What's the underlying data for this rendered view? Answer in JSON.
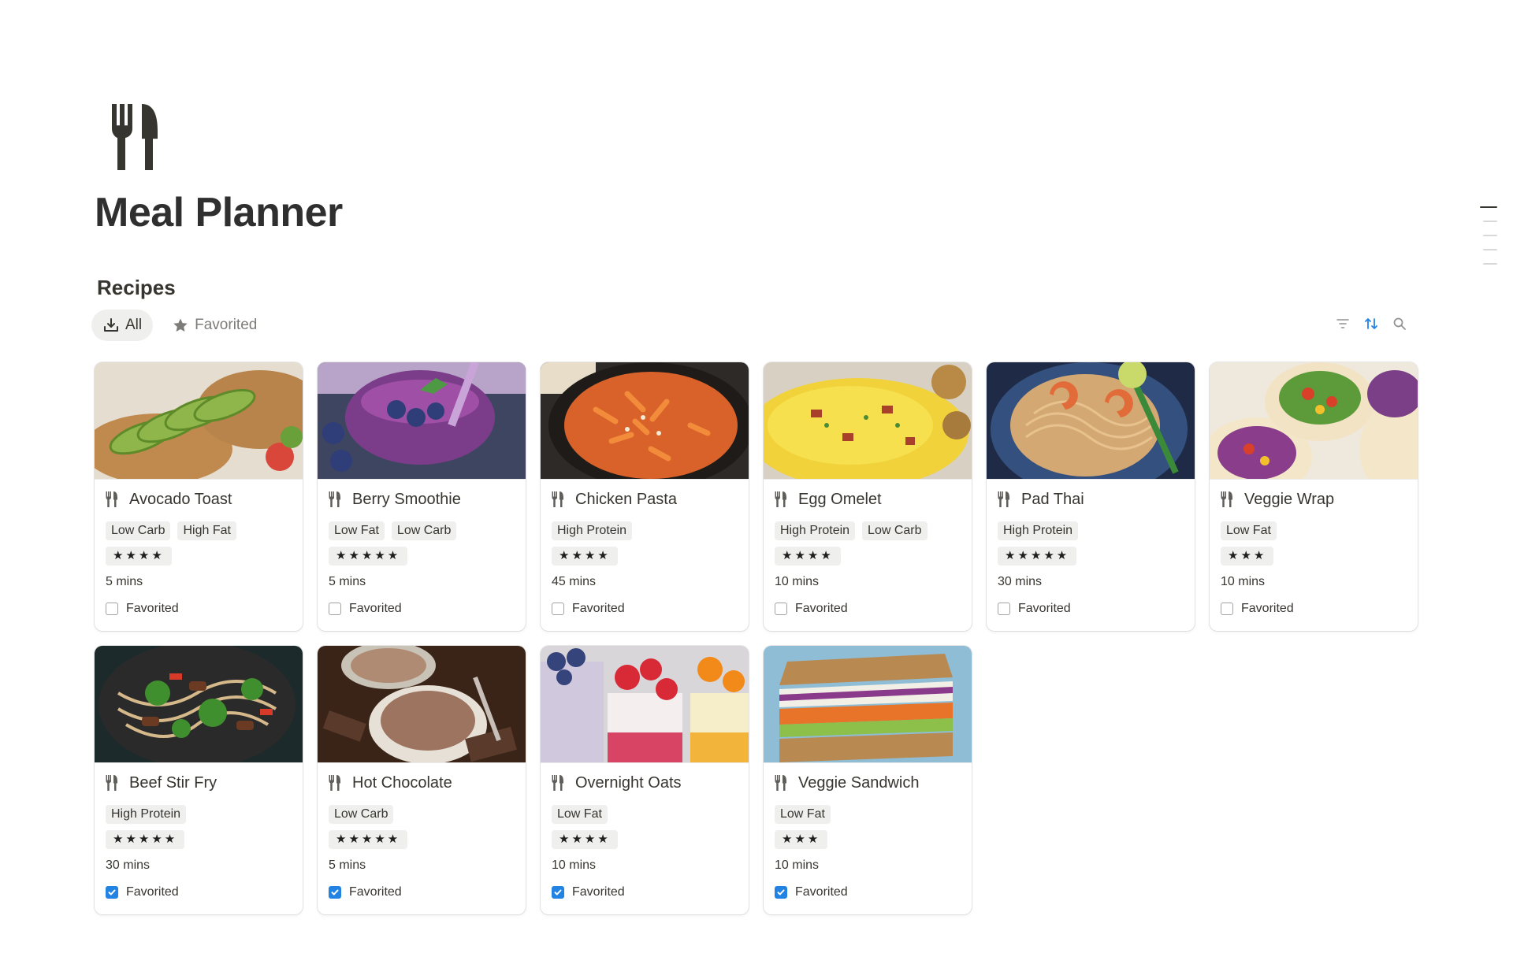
{
  "page": {
    "title": "Meal Planner",
    "icon": "fork-knife-icon"
  },
  "section": {
    "title": "Recipes"
  },
  "tabs": [
    {
      "label": "All",
      "icon": "download-icon",
      "active": true
    },
    {
      "label": "Favorited",
      "icon": "star-icon",
      "active": false
    }
  ],
  "toolbar": {
    "icons": [
      "filter-icon",
      "sort-icon",
      "search-icon"
    ],
    "accent": "#2383e2"
  },
  "recipes": [
    {
      "name": "Avocado Toast",
      "tags": [
        "Low Carb",
        "High Fat"
      ],
      "stars": "★★★★",
      "rating": 4,
      "time": "5 mins",
      "favorited": false,
      "favorited_label": "Favorited"
    },
    {
      "name": "Berry Smoothie",
      "tags": [
        "Low Fat",
        "Low Carb"
      ],
      "stars": "★★★★★",
      "rating": 5,
      "time": "5 mins",
      "favorited": false,
      "favorited_label": "Favorited"
    },
    {
      "name": "Chicken Pasta",
      "tags": [
        "High Protein"
      ],
      "stars": "★★★★",
      "rating": 4,
      "time": "45 mins",
      "favorited": false,
      "favorited_label": "Favorited"
    },
    {
      "name": "Egg Omelet",
      "tags": [
        "High Protein",
        "Low Carb"
      ],
      "stars": "★★★★",
      "rating": 4,
      "time": "10 mins",
      "favorited": false,
      "favorited_label": "Favorited"
    },
    {
      "name": "Pad Thai",
      "tags": [
        "High Protein"
      ],
      "stars": "★★★★★",
      "rating": 5,
      "time": "30 mins",
      "favorited": false,
      "favorited_label": "Favorited"
    },
    {
      "name": "Veggie Wrap",
      "tags": [
        "Low Fat"
      ],
      "stars": "★★★",
      "rating": 3,
      "time": "10 mins",
      "favorited": false,
      "favorited_label": "Favorited"
    },
    {
      "name": "Beef Stir Fry",
      "tags": [
        "High Protein"
      ],
      "stars": "★★★★★",
      "rating": 5,
      "time": "30 mins",
      "favorited": true,
      "favorited_label": "Favorited"
    },
    {
      "name": "Hot Chocolate",
      "tags": [
        "Low Carb"
      ],
      "stars": "★★★★★",
      "rating": 5,
      "time": "5 mins",
      "favorited": true,
      "favorited_label": "Favorited"
    },
    {
      "name": "Overnight Oats",
      "tags": [
        "Low Fat"
      ],
      "stars": "★★★★",
      "rating": 4,
      "time": "10 mins",
      "favorited": true,
      "favorited_label": "Favorited"
    },
    {
      "name": "Veggie Sandwich",
      "tags": [
        "Low Fat"
      ],
      "stars": "★★★",
      "rating": 3,
      "time": "10 mins",
      "favorited": true,
      "favorited_label": "Favorited"
    }
  ]
}
